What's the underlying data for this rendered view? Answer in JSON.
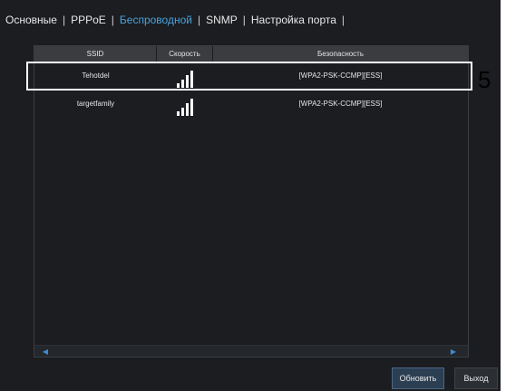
{
  "tabs": [
    {
      "label": "Основные"
    },
    {
      "label": "PPPoE"
    },
    {
      "label": "Беспроводной"
    },
    {
      "label": "SNMP"
    },
    {
      "label": "Настройка порта"
    }
  ],
  "tab_separator": "|",
  "active_tab": "Беспроводной",
  "table": {
    "headers": {
      "ssid": "SSID",
      "speed": "Скорость",
      "security": "Безопасность"
    },
    "rows": [
      {
        "ssid": "Tehotdel",
        "security": "[WPA2-PSK-CCMP][ESS]",
        "signal_bars": 4
      },
      {
        "ssid": "targetfamily",
        "security": "[WPA2-PSK-CCMP][ESS]",
        "signal_bars": 4
      }
    ]
  },
  "callout": {
    "number": "5"
  },
  "buttons": {
    "refresh": "Обновить",
    "exit": "Выход"
  },
  "colors": {
    "accent": "#4aa3df",
    "panel": "#1b1d21",
    "header": "#3a3c40"
  }
}
